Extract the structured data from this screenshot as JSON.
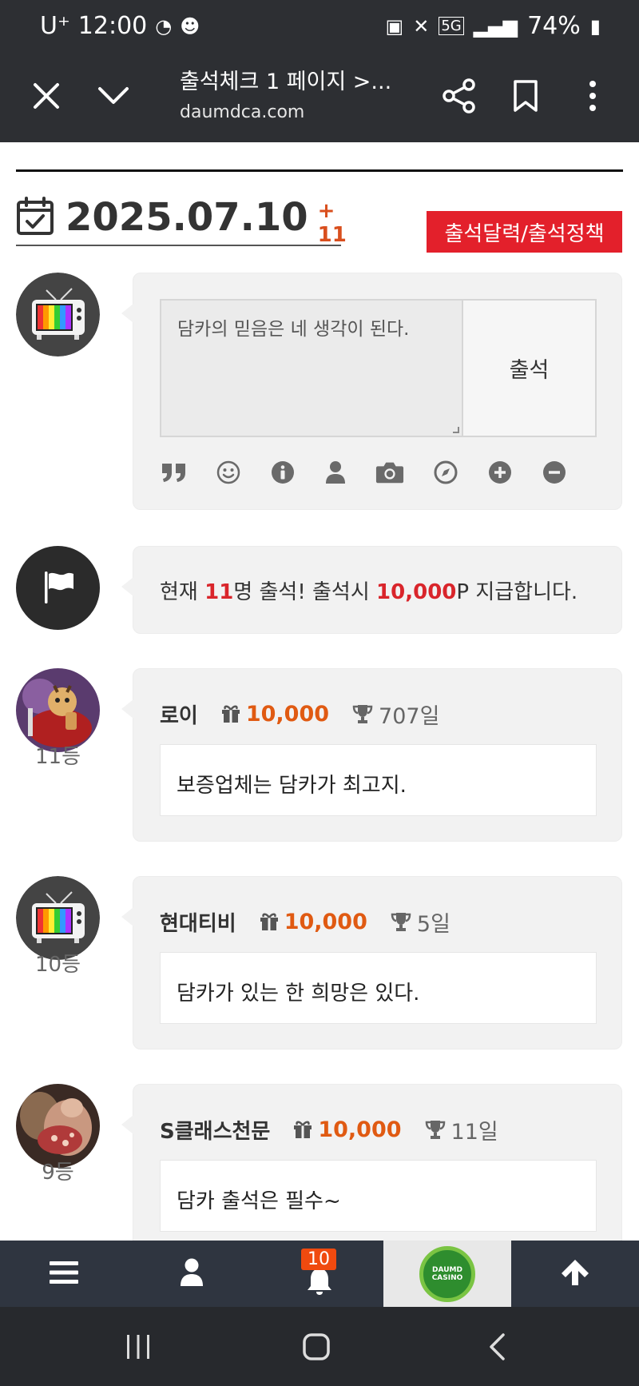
{
  "status_bar": {
    "carrier": "U⁺",
    "time": "12:00",
    "network": "5G",
    "battery": "74%"
  },
  "toolbar": {
    "page_title": "출석체크 1 페이지 >...",
    "url": "daumdca.com"
  },
  "header": {
    "date": "2025.07.10",
    "count_badge": "+ 11",
    "policy_button": "출석달력/출석정책"
  },
  "compose": {
    "placeholder": "담카의 믿음은 네 생각이 된다.",
    "submit_label": "출석",
    "toolbar_icons": [
      "quote-icon",
      "smile-icon",
      "info-icon",
      "user-icon",
      "camera-icon",
      "compass-icon",
      "plus-circle-icon",
      "minus-circle-icon"
    ]
  },
  "notice": {
    "prefix": "현재 ",
    "count": "11",
    "middle": "명 출석! 출석시 ",
    "points": "10,000",
    "suffix": "P 지급합니다."
  },
  "entries": [
    {
      "name": "로이",
      "points": "10,000",
      "days": "707일",
      "message": "보증업체는 담카가 최고지.",
      "rank": "11등"
    },
    {
      "name": "현대티비",
      "points": "10,000",
      "days": "5일",
      "message": "담카가 있는 한 희망은 있다.",
      "rank": "10등"
    },
    {
      "name": "S클래스천문",
      "points": "10,000",
      "days": "11일",
      "message": "담카 출석은 필수~",
      "rank": "9등"
    }
  ],
  "bottom_nav": {
    "notification_count": "10",
    "logo_text": "DAUMD CASINO"
  },
  "colors": {
    "accent_red": "#e3202b",
    "points_orange": "#e05a12",
    "toolbar_bg": "#2d2f33"
  }
}
